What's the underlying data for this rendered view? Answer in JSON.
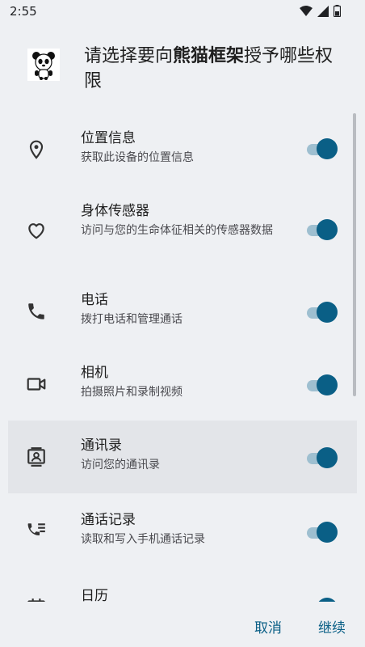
{
  "status_bar": {
    "time": "2:55"
  },
  "dialog": {
    "title_prefix": "请选择要向",
    "app_name": "熊猫框架",
    "title_suffix": "授予哪些权限"
  },
  "permissions": [
    {
      "label": "位置信息",
      "description": "获取此设备的位置信息",
      "icon": "location-pin-icon",
      "enabled": true
    },
    {
      "label": "身体传感器",
      "description": "访问与您的生命体征相关的传感器数据",
      "icon": "heart-icon",
      "enabled": true
    },
    {
      "label": "电话",
      "description": "拨打电话和管理通话",
      "icon": "phone-icon",
      "enabled": true
    },
    {
      "label": "相机",
      "description": "拍摄照片和录制视频",
      "icon": "camera-icon",
      "enabled": true
    },
    {
      "label": "通讯录",
      "description": "访问您的通讯录",
      "icon": "contacts-icon",
      "enabled": true
    },
    {
      "label": "通话记录",
      "description": "读取和写入手机通话记录",
      "icon": "call-log-icon",
      "enabled": true
    },
    {
      "label": "日历",
      "description": "",
      "icon": "calendar-icon",
      "enabled": true
    }
  ],
  "buttons": {
    "cancel": "取消",
    "continue": "继续"
  },
  "colors": {
    "accent": "#0a5f86",
    "track": "#9ebfd0",
    "background": "#eef0f3"
  }
}
